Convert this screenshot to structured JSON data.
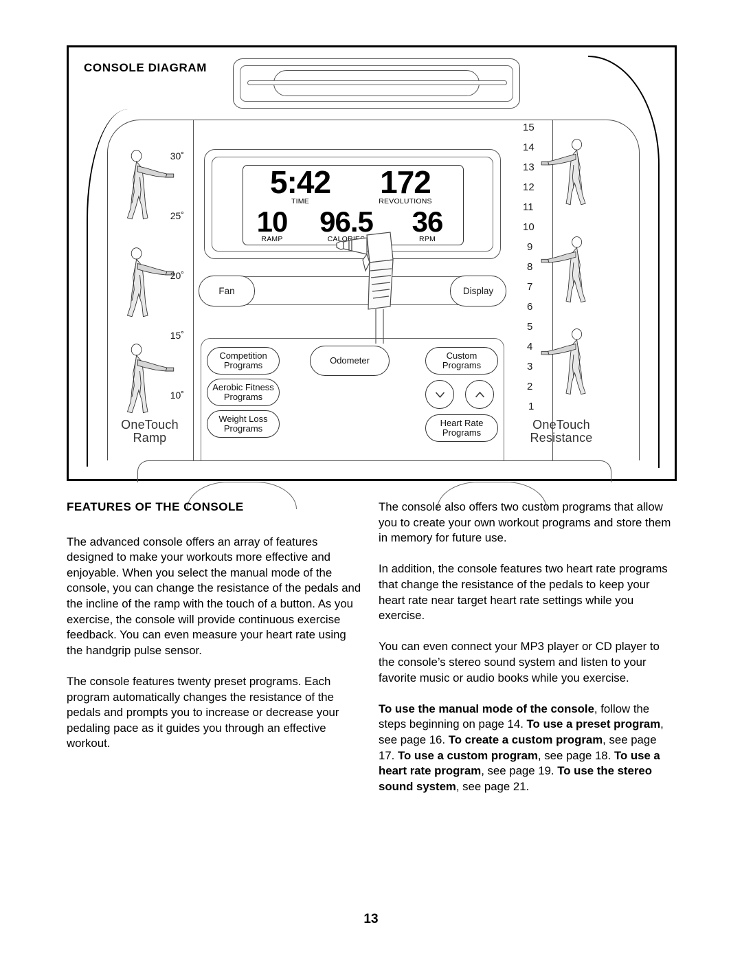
{
  "page": {
    "number": "13"
  },
  "diagram": {
    "title": "CONSOLE DIAGRAM",
    "display": {
      "readouts_top": [
        {
          "value": "5:42",
          "caption": "TIME"
        },
        {
          "value": "172",
          "caption": "REVOLUTIONS"
        }
      ],
      "readouts_bottom": [
        {
          "value": "10",
          "caption": "RAMP"
        },
        {
          "value": "96.5",
          "caption": "CALORIES"
        },
        {
          "value": "36",
          "caption": "RPM"
        }
      ]
    },
    "top_bar_buttons": [
      {
        "label": "Fan",
        "name": "fan-button"
      },
      {
        "label": "Display",
        "name": "display-button"
      }
    ],
    "keypad_buttons": [
      {
        "label": "Competition\nPrograms",
        "name": "competition-programs-button"
      },
      {
        "label": "Aerobic Fitness\nPrograms",
        "name": "aerobic-fitness-programs-button"
      },
      {
        "label": "Weight Loss\nPrograms",
        "name": "weight-loss-programs-button"
      },
      {
        "label": "Odometer",
        "name": "odometer-button"
      },
      {
        "label": "Custom\nPrograms",
        "name": "custom-programs-button"
      },
      {
        "label": "Heart Rate\nPrograms",
        "name": "heart-rate-programs-button"
      }
    ],
    "arrow_buttons": [
      {
        "icon": "chevron-down-icon",
        "name": "decrease-button"
      },
      {
        "icon": "chevron-up-icon",
        "name": "increase-button"
      }
    ],
    "ramp_column": {
      "caption": "OneTouch\nRamp",
      "caption_line1": "OneTouch",
      "caption_line2": "Ramp",
      "labels": [
        "30˚",
        "25˚",
        "20˚",
        "15˚",
        "10˚"
      ]
    },
    "resistance_column": {
      "caption_line1": "OneTouch",
      "caption_line2": "Resistance",
      "labels": [
        "15",
        "14",
        "13",
        "12",
        "11",
        "10",
        "9",
        "8",
        "7",
        "6",
        "5",
        "4",
        "3",
        "2",
        "1"
      ]
    }
  },
  "content": {
    "section_heading": "FEATURES OF THE CONSOLE",
    "left_paragraphs": [
      "The advanced console offers an array of features designed to make your workouts more effective and enjoyable. When you select the manual mode of the console, you can change the resistance of the pedals and the incline of the ramp with the touch of a button. As you exercise, the console will provide continuous exercise feedback. You can even measure your heart rate using the handgrip pulse sensor.",
      "The console features twenty preset programs. Each program automatically changes the resistance of the pedals and prompts you to increase or decrease your pedaling pace as it guides you through an effective workout."
    ],
    "right_paragraphs": [
      "The console also offers two custom programs that allow you to create your own workout programs and store them in memory for future use.",
      "In addition, the console features two heart rate programs that change the resistance of the pedals to keep your heart rate near target heart rate settings while you exercise.",
      "You can even connect your MP3 player or CD player to the console’s stereo sound system and listen to your favorite music or audio books while you exercise."
    ],
    "cross_references": {
      "b1": "To use the manual mode of the console",
      "t1": ", follow the steps beginning on page 14. ",
      "b2": "To use a preset program",
      "t2": ", see page 16. ",
      "b3": "To create a custom program",
      "t3": ", see page 17. ",
      "b4": "To use a custom program",
      "t4": ", see page 18. ",
      "b5": "To use a heart rate program",
      "t5": ", see page 19. ",
      "b6": "To use the stereo sound system",
      "t6": ", see page 21."
    }
  }
}
